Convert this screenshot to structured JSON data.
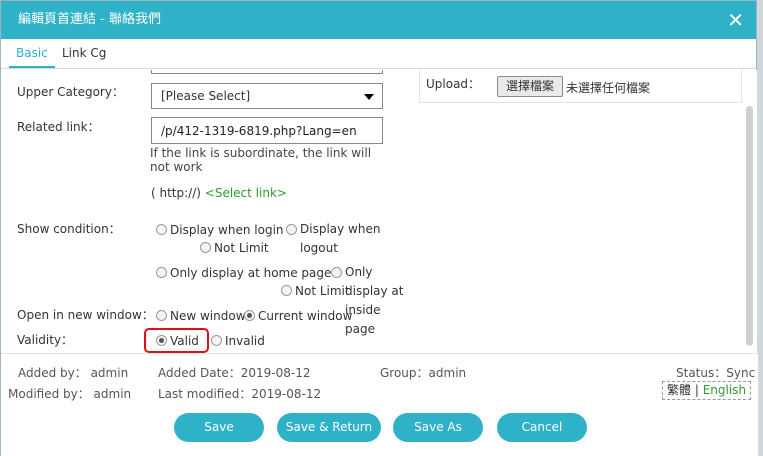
{
  "window": {
    "title": "編輯頁首連結 - 聯絡我們",
    "close_glyph": "✕"
  },
  "tabs": [
    {
      "label": "Basic",
      "active": true
    },
    {
      "label": "Link Cg",
      "active": false
    }
  ],
  "form": {
    "upper_category": {
      "label": "Upper Category：",
      "value": "[Please Select]"
    },
    "related_link": {
      "label": "Related link：",
      "value": "/p/412-1319-6819.php?Lang=en",
      "hint": "If the link is subordinate, the link will not work",
      "prefix": "( http://)",
      "select_link": "<Select link>"
    },
    "upload": {
      "label": "Upload：",
      "button": "選擇檔案",
      "status": "未選擇任何檔案"
    },
    "show_condition": {
      "label": "Show condition：",
      "row1": [
        "Display when login",
        "Display when logout",
        "Not Limit"
      ],
      "row2": [
        "Only display at home page",
        "Only display at inside page",
        "Not Limit"
      ]
    },
    "open_new_window": {
      "label": "Open in new window：",
      "options": [
        "New window",
        "Current window"
      ],
      "selected": "Current window"
    },
    "validity": {
      "label": "Validity：",
      "options": [
        "Valid",
        "Invalid"
      ],
      "selected": "Valid"
    }
  },
  "meta": {
    "added_by": "Added by： admin",
    "added_date": "Added Date：2019-08-12",
    "group": "Group：admin",
    "status": "Status：Sync",
    "modified_by": "Modified by： admin",
    "last_modified": "Last modified：2019-08-12",
    "lang_tc": "繁體",
    "lang_sep": "|",
    "lang_en": "English"
  },
  "buttons": {
    "save": "Save",
    "save_return": "Save & Return",
    "save_as": "Save As",
    "cancel": "Cancel"
  },
  "colors": {
    "accent": "#2fb2c8",
    "link_green": "#2e9b2e",
    "highlight_red": "#e01010"
  }
}
